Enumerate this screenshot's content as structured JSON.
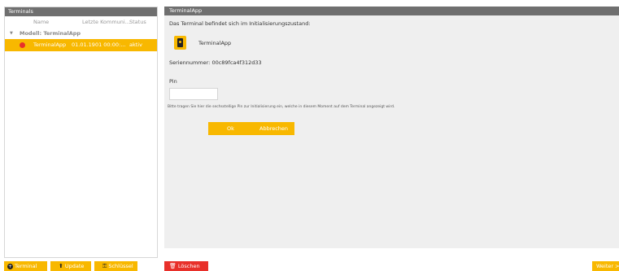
{
  "left_panel": {
    "title": "Terminals",
    "columns": [
      "Name",
      "Letzte Kommuni...",
      "Status"
    ],
    "group_label": "Modell: TerminalApp",
    "rows": [
      {
        "name": "TerminalApp",
        "last_comm": "01.01.1901 00:00:...",
        "status": "aktiv"
      }
    ]
  },
  "right_panel": {
    "title": "TerminalApp",
    "message": "Das Terminal befindet sich im Initialisierungszustand:",
    "app_name": "TerminalApp",
    "serial": "Seriennummer: 00c89fca4f312d33",
    "pin_label": "Pin",
    "pin_value": "",
    "hint": "Bitte tragen Sie hier die sechsstellige Pin zur Initialisierung ein, welche in diesem Moment auf dem Terminal angezeigt wird.",
    "ok_label": "Ok",
    "cancel_label": "Abbrechen"
  },
  "bottom": {
    "terminal_label": "Terminal",
    "update_label": "Update",
    "key_label": "Schlüssel",
    "delete_label": "Löschen",
    "next_label": "Weiter"
  },
  "colors": {
    "accent": "#f8b800",
    "header": "#6f6f6f",
    "delete": "#e8302a",
    "status_dot": "#e8302a"
  }
}
